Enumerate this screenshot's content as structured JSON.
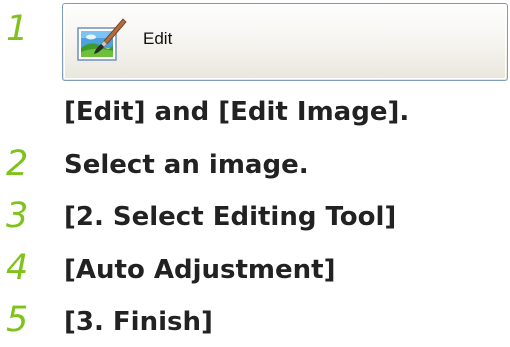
{
  "steps": [
    {
      "number": "1",
      "button": {
        "label": "Edit",
        "icon": "edit-image-icon"
      },
      "text": "[Edit] and [Edit Image]."
    },
    {
      "number": "2",
      "text": "Select an image."
    },
    {
      "number": "3",
      "text": "[2. Select Editing Tool]"
    },
    {
      "number": "4",
      "text": "[Auto Adjustment]"
    },
    {
      "number": "5",
      "text": "[3. Finish]"
    }
  ],
  "colors": {
    "step_number": "#7fc21c",
    "step_text": "#222222",
    "button_border": "#7f9db9"
  }
}
